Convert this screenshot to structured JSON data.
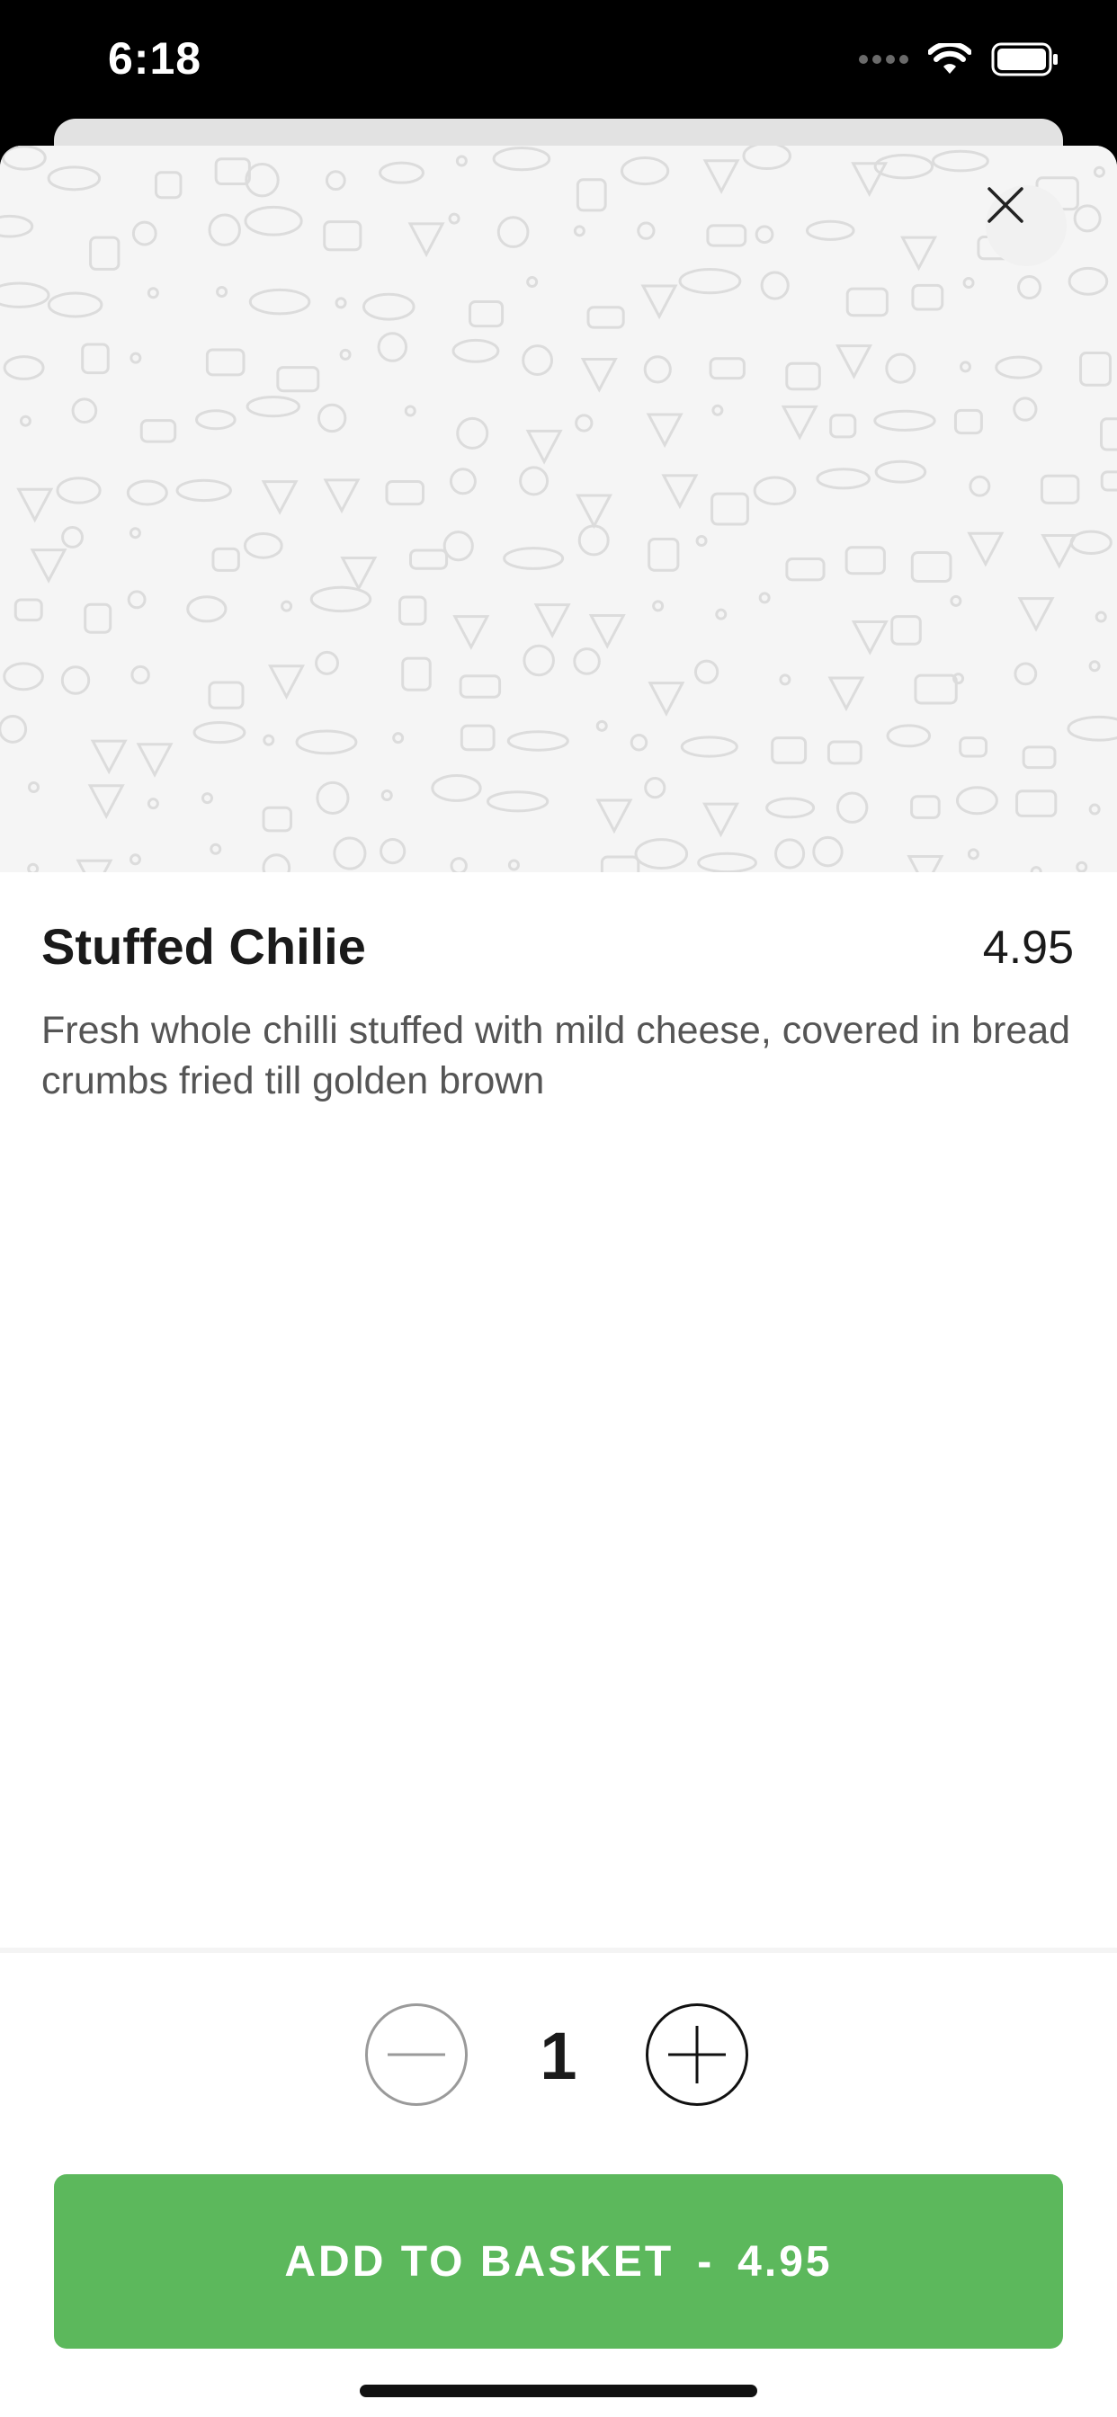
{
  "status_bar": {
    "time": "6:18"
  },
  "icons": {
    "close": "close-icon",
    "minus": "minus-icon",
    "plus": "plus-icon",
    "wifi": "wifi-icon",
    "battery": "battery-icon",
    "signal": "cellular-signal-icon",
    "hero_pattern": "food-doodle-pattern"
  },
  "item": {
    "name": "Stuffed Chilie",
    "price": "4.95",
    "description": "Fresh whole chilli stuffed with mild cheese, covered in bread crumbs fried till golden brown"
  },
  "quantity": {
    "value": "1"
  },
  "add_button": {
    "label": "ADD TO BASKET",
    "separator": "-",
    "total": "4.95"
  },
  "colors": {
    "accent_green": "#5cb85c",
    "hero_background": "#f5f5f5",
    "status_bar_background": "#000000"
  }
}
